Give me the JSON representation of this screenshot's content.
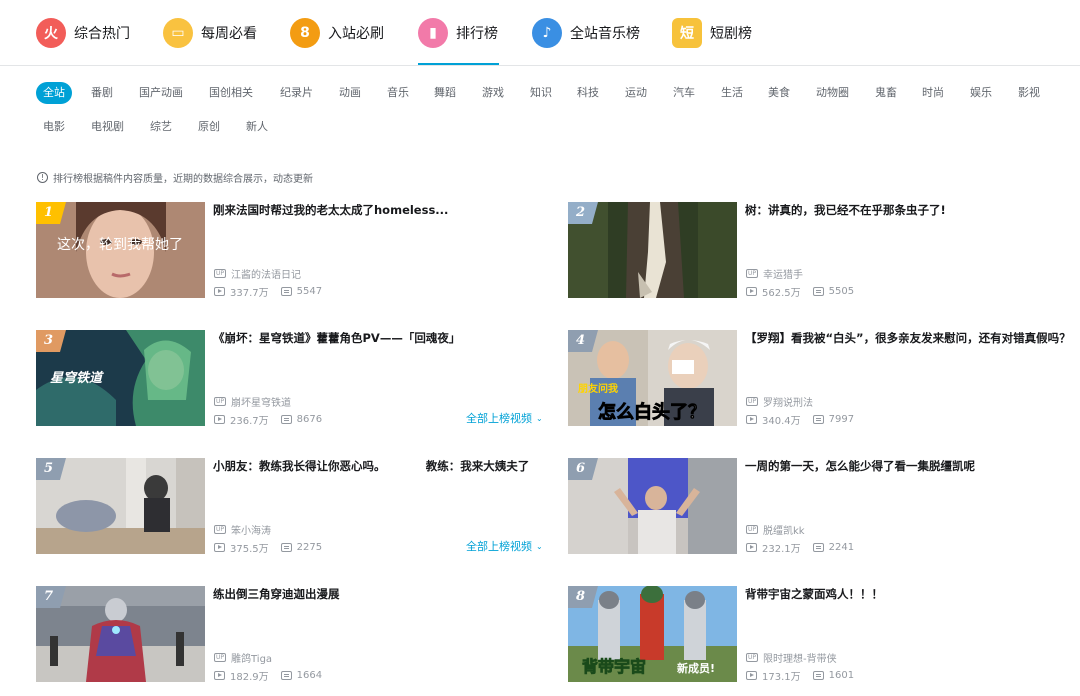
{
  "nav": [
    {
      "label": "综合热门",
      "color": "#f25d59",
      "glyph": "火"
    },
    {
      "label": "每周必看",
      "color": "#f9c240",
      "glyph": "▭"
    },
    {
      "label": "入站必刷",
      "color": "#f39c12",
      "glyph": "8"
    },
    {
      "label": "排行榜",
      "color": "#f27aa9",
      "glyph": "▮"
    },
    {
      "label": "全站音乐榜",
      "color": "#3a8fe3",
      "glyph": "♪"
    },
    {
      "label": "短剧榜",
      "color": "#f7c23b",
      "glyph": "短"
    }
  ],
  "categories_row1": [
    "全站",
    "番剧",
    "国产动画",
    "国创相关",
    "纪录片",
    "动画",
    "音乐",
    "舞蹈",
    "游戏",
    "知识",
    "科技",
    "运动",
    "汽车",
    "生活",
    "美食",
    "动物圈",
    "鬼畜",
    "时尚",
    "娱乐",
    "影视"
  ],
  "categories_row2": [
    "电影",
    "电视剧",
    "综艺",
    "原创",
    "新人"
  ],
  "tip": "排行榜根据稿件内容质量，近期的数据综合展示，动态更新",
  "more_label": "全部上榜视频",
  "videos": [
    {
      "rank": "1",
      "title": "刚来法国时帮过我的老太太成了homeless...",
      "up": "江酱的法语日记",
      "views": "337.7万",
      "danmaku": "5547",
      "overlay": "这次，轮到我帮她了"
    },
    {
      "rank": "2",
      "title": "树：讲真的，我已经不在乎那条虫子了!",
      "up": "幸运猎手",
      "views": "562.5万",
      "danmaku": "5505",
      "overlay": ""
    },
    {
      "rank": "3",
      "title": "《崩坏：星穹铁道》藿藿角色PV——「回魂夜」",
      "up": "崩坏星穹铁道",
      "views": "236.7万",
      "danmaku": "8676",
      "overlay": "星穹铁道"
    },
    {
      "rank": "4",
      "title": "【罗翔】看我被“白头”，很多亲友发来慰问，还有对错真假吗？",
      "up": "罗翔说刑法",
      "views": "340.4万",
      "danmaku": "7997",
      "overlay": "怎么白头了？",
      "overlay2": "朋友问我"
    },
    {
      "rank": "5",
      "title": "小朋友：教练我长得让你恶心吗。　　　　教练：我来大姨夫了",
      "up": "笨小海涛",
      "views": "375.5万",
      "danmaku": "2275",
      "overlay": ""
    },
    {
      "rank": "6",
      "title": "一周的第一天，怎么能少得了看一集脱缰凯呢",
      "up": "脱缰凯kk",
      "views": "232.1万",
      "danmaku": "2241",
      "overlay": ""
    },
    {
      "rank": "7",
      "title": "练出倒三角穿迪迦出漫展",
      "up": "雕鸽Tiga",
      "views": "182.9万",
      "danmaku": "1664",
      "overlay": ""
    },
    {
      "rank": "8",
      "title": "背带宇宙之蒙面鸡人！！！",
      "up": "限时理想-背带侠",
      "views": "173.1万",
      "danmaku": "1601",
      "overlay": "背带宇宙",
      "overlay2": "新成员!"
    }
  ],
  "colors": {
    "accent": "#00a1d6",
    "rank1": "#ffc000",
    "rank2": "#94aec8",
    "rank3": "#e09a62",
    "rank_other": "#8f9eb0"
  }
}
